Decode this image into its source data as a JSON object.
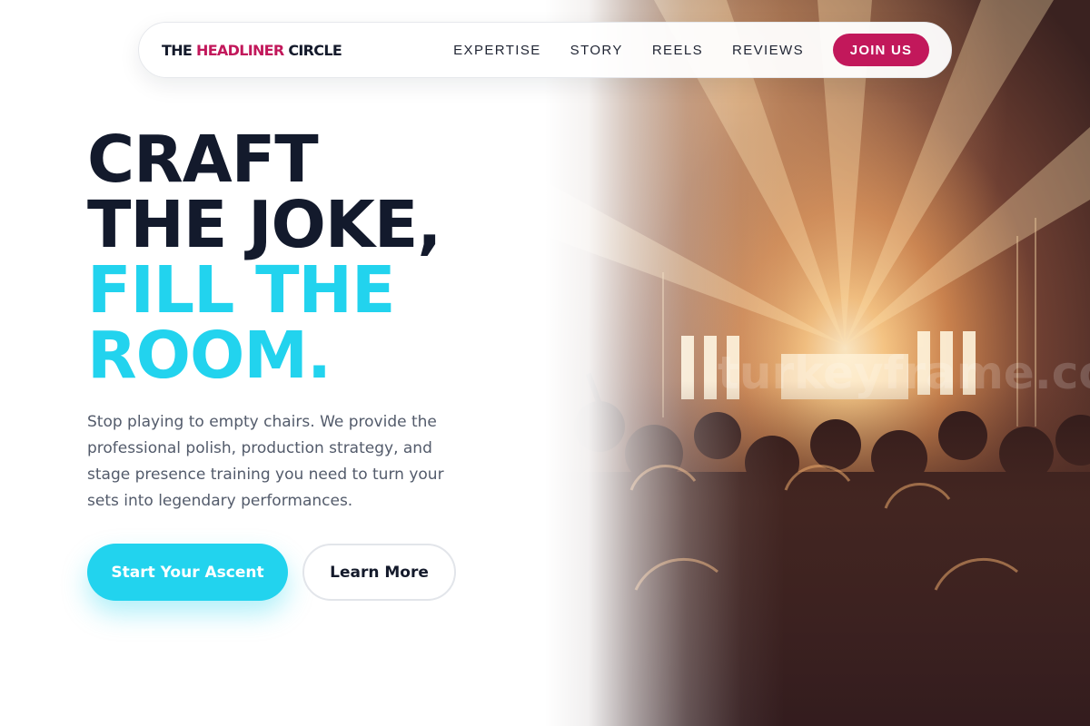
{
  "nav": {
    "brand_part1": "THE ",
    "brand_accent": "HEADLINER",
    "brand_part2": " CIRCLE",
    "links": [
      "EXPERTISE",
      "STORY",
      "REELS",
      "REVIEWS"
    ],
    "cta": "JOIN US"
  },
  "hero": {
    "headline_lines": [
      "CRAFT",
      "THE JOKE,",
      "FILL THE",
      "ROOM."
    ],
    "description": "Stop playing to empty chairs. We provide the professional polish, production strategy, and stage presence training you need to turn your sets into legendary performances.",
    "primary_button": "Start Your Ascent",
    "secondary_button": "Learn More",
    "image_description": "concert-crowd-stage-lights",
    "watermark": "turkeyframe.com"
  },
  "colors": {
    "accent_pink": "#c2185b",
    "accent_cyan": "#22d3ee",
    "headline_dark": "#131a2c",
    "text_gray": "#535b6b"
  }
}
